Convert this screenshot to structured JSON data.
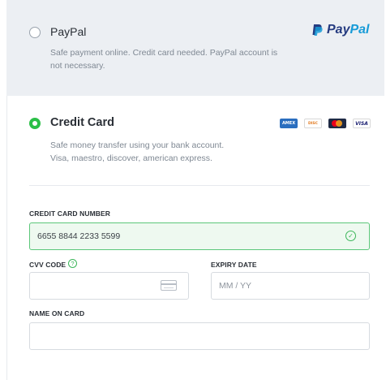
{
  "paypal_option": {
    "title": "PayPal",
    "description_line1": "Safe payment online. Credit card needed. PayPal account is",
    "description_line2": "not necessary.",
    "logo_text": "PayPal",
    "selected": false
  },
  "credit_card_option": {
    "title": "Credit Card",
    "description_line1": "Safe money transfer using your bank account.",
    "description_line2": "Visa, maestro, discover, american express.",
    "selected": true,
    "card_brands": [
      "AMERICAN EXPRESS",
      "DISCOVER",
      "MASTERCARD",
      "VISA"
    ]
  },
  "form": {
    "card_number_label": "CREDIT CARD NUMBER",
    "card_number_value": "6655 8844 2233 5599",
    "cvv_label": "CVV CODE",
    "cvv_help": "?",
    "expiry_label": "EXPIRY DATE",
    "expiry_placeholder": "MM / YY",
    "name_label": "NAME ON CARD",
    "name_value": ""
  },
  "colors": {
    "accent_green": "#2bbf47",
    "paypal_dark": "#253b80",
    "paypal_light": "#179bd7",
    "valid_bg": "#eef9f0"
  }
}
